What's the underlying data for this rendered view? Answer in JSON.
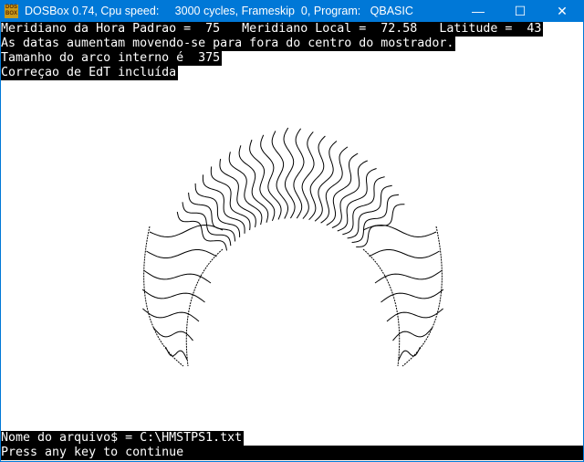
{
  "window": {
    "title": "DOSBox 0.74, Cpu speed:     3000 cycles, Frameskip  0, Program:   QBASIC",
    "icon_label": "DOS BOX",
    "minimize_icon": "minimize-icon",
    "maximize_icon": "maximize-icon",
    "close_icon": "close-icon",
    "accent": "#0078d7"
  },
  "console": {
    "header_lines": [
      "Meridiano da Hora Padrao =  75   Meridiano Local =  72.58   Latitude =  43",
      "As datas aumentam movendo-se para fora do centro do mostrador.",
      "Tamanho do arco interno é  375",
      "Correçao de EdT incluída"
    ],
    "file_line": "Nome do arquivo$ = C:\\HMSTPS1.txt",
    "prompt_line": "Press any key to continue"
  }
}
